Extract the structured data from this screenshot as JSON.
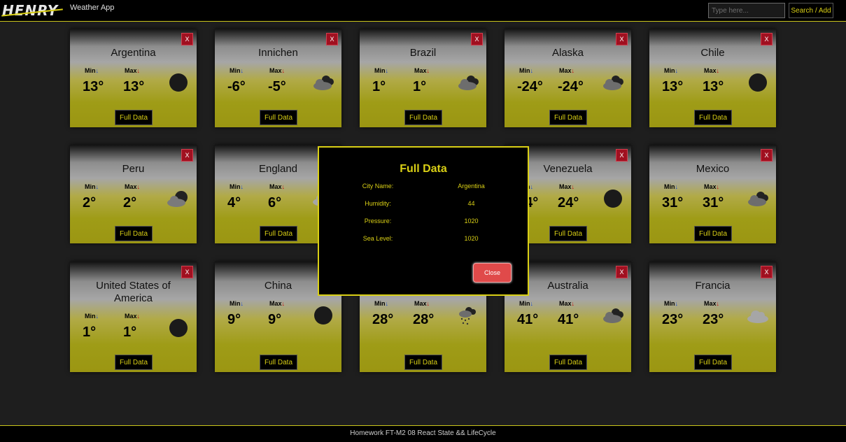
{
  "navbar": {
    "logo": "HENRY",
    "title": "Weather App",
    "search_placeholder": "Type here...",
    "search_button": "Search / Add"
  },
  "labels": {
    "min": "Min",
    "max": "Max",
    "min_arrow": "↓",
    "max_arrow": "↓",
    "close": "X",
    "full_data": "Full Data"
  },
  "cities": [
    {
      "name": "Argentina",
      "min": "13°",
      "max": "13°",
      "icon": "moon-icon"
    },
    {
      "name": "Innichen",
      "min": "-6°",
      "max": "-5°",
      "icon": "broken-clouds-icon"
    },
    {
      "name": "Brazil",
      "min": "1°",
      "max": "1°",
      "icon": "broken-clouds-icon"
    },
    {
      "name": "Alaska",
      "min": "-24°",
      "max": "-24°",
      "icon": "broken-clouds-icon"
    },
    {
      "name": "Chile",
      "min": "13°",
      "max": "13°",
      "icon": "moon-icon"
    },
    {
      "name": "Peru",
      "min": "2°",
      "max": "2°",
      "icon": "cloudy-night-icon"
    },
    {
      "name": "England",
      "min": "4°",
      "max": "6°",
      "icon": "cloud-icon"
    },
    {
      "name": "",
      "min": "",
      "max": "",
      "icon": ""
    },
    {
      "name": "Venezuela",
      "min": "24°",
      "max": "24°",
      "icon": "moon-icon"
    },
    {
      "name": "Mexico",
      "min": "31°",
      "max": "31°",
      "icon": "broken-clouds-icon"
    },
    {
      "name": "United States of America",
      "min": "1°",
      "max": "1°",
      "icon": "moon-icon"
    },
    {
      "name": "China",
      "min": "9°",
      "max": "9°",
      "icon": "moon-icon"
    },
    {
      "name": "",
      "min": "28°",
      "max": "28°",
      "icon": "snow-icon"
    },
    {
      "name": "Australia",
      "min": "41°",
      "max": "41°",
      "icon": "broken-clouds-icon"
    },
    {
      "name": "Francia",
      "min": "23°",
      "max": "23°",
      "icon": "cloud-icon"
    }
  ],
  "modal": {
    "title": "Full Data",
    "rows": [
      {
        "label": "City Name:",
        "value": "Argentina"
      },
      {
        "label": "Humidity:",
        "value": "44"
      },
      {
        "label": "Pressure:",
        "value": "1020"
      },
      {
        "label": "Sea Level:",
        "value": "1020"
      }
    ],
    "close": "Close"
  },
  "footer": {
    "text": "Homework FT-M2 08 React State && LifeCycle"
  },
  "colors": {
    "accent": "#d9cf15",
    "close_red": "#a01020",
    "modal_close": "#e04a4a"
  }
}
